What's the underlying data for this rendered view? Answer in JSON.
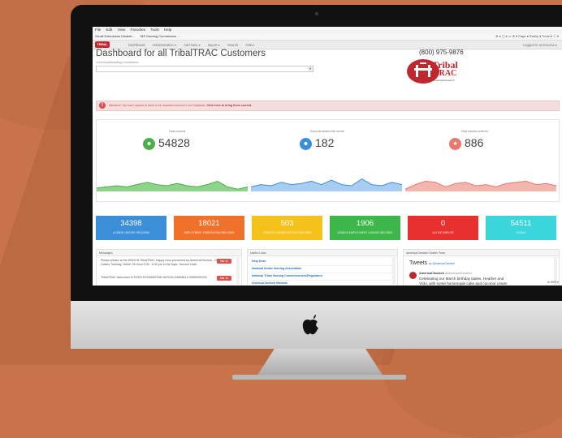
{
  "browser": {
    "menu": [
      "File",
      "Edit",
      "View",
      "Favorites",
      "Tools",
      "Help"
    ],
    "favorites": [
      "Gmail Extensions Disable...",
      "MS Gaming Commission ..."
    ],
    "tools": "⊕ ▾ ▢ ▾ ▭ ⊕ ▾ Page ▾ Safety ▾ Tools ▾ ⓘ ▾",
    "zoom": "⊕ 80% ▾"
  },
  "nav": {
    "logo": "TRIBAL",
    "links": [
      "Dashboard",
      "Administration ▾",
      "Add New ▾",
      "Import ▾",
      "Search",
      "Order"
    ],
    "account": "Logged in as Inscrna ▾"
  },
  "header": {
    "title": "Dashboard for all TribalTRAC Customers",
    "select_label": "Current participating Commission:",
    "phone": "(800) 975-9876",
    "brand_tribal": "Tribal",
    "brand_trac": "TRAC",
    "brand_sub": "AmericaChecked ©"
  },
  "alert": {
    "icon": "!",
    "text": "Attention! You have reports in store to be reported records in our Database. ",
    "link": "Click here to bring them current."
  },
  "stats": [
    {
      "title": "Total records",
      "value": "54828",
      "icon": "user-icon",
      "glyph": "☻",
      "color": "#4cae4c",
      "fill": "#8fd48a",
      "points": [
        0.15,
        0.2,
        0.25,
        0.2,
        0.3,
        0.4,
        0.3,
        0.25,
        0.35,
        0.25,
        0.2,
        0.3,
        0.45,
        0.2,
        0.1,
        0.2
      ]
    },
    {
      "title": "Records added this month",
      "value": "182",
      "icon": "user-icon",
      "glyph": "☻",
      "color": "#3a8fd8",
      "fill": "#a8cdf0",
      "points": [
        0.2,
        0.3,
        0.25,
        0.4,
        0.3,
        0.35,
        0.45,
        0.3,
        0.5,
        0.3,
        0.25,
        0.55,
        0.3,
        0.25,
        0.4,
        0.3
      ]
    },
    {
      "title": "Total reports ordered",
      "value": "886",
      "icon": "star-icon",
      "glyph": "★",
      "color": "#e77a6f",
      "fill": "#f2b6ae",
      "points": [
        0.1,
        0.3,
        0.45,
        0.4,
        0.2,
        0.35,
        0.4,
        0.25,
        0.3,
        0.2,
        0.35,
        0.4,
        0.45,
        0.3,
        0.35,
        0.25
      ]
    }
  ],
  "tiles": [
    {
      "value": "34398",
      "label": "LICENSE HISTORY RECORDS",
      "color": "#3a8fd8"
    },
    {
      "value": "18021",
      "label": "EMPLOYMENT VERIFICATION RECORDS",
      "color": "#f0712a"
    },
    {
      "value": "503",
      "label": "VENDOR LICENSE HISTORY RECORDS",
      "color": "#f5c21b"
    },
    {
      "value": "1906",
      "label": "VENDOR EMPLOYMENT LICENSE RECORDS",
      "color": "#3db64a"
    },
    {
      "value": "0",
      "label": "ACTIVE DISPUTE",
      "color": "#e8312e"
    },
    {
      "value": "54511",
      "label": "TOTALS",
      "color": "#3ad6dc"
    }
  ],
  "messages": {
    "title": "Messages",
    "items": [
      {
        "text": "Please please at the WSGCN TribalTRAC Happy Hour presented by AmericaChecked - Hard Rock Casino Tuesday, March 7th from 5:30 - 6:30 pm in the foyer, Second Level.",
        "badge": "Mar 10"
      },
      {
        "text": "TribalTRAC welcomes CITIZEN POTAWATOMI NATION GAMING COMMISSION!",
        "badge": "Mar 10"
      }
    ]
  },
  "links": {
    "title": "Useful Links",
    "items": [
      "Help Desk",
      "National Indian Gaming Association",
      "National Tribal Gaming Commissioners/Regulators",
      "AmericaChecked Website"
    ]
  },
  "twitter": {
    "title": "AmericaChecked Twitter Feed",
    "heading": "Tweets",
    "handle": "by @AmericaChecked",
    "author": "AmericaChecked",
    "author_handle": "@AmericaChecked",
    "text": "Celebrating our March birthday ladies, Heather and Vicki, with some homemade cake and coconut cream pie!"
  }
}
